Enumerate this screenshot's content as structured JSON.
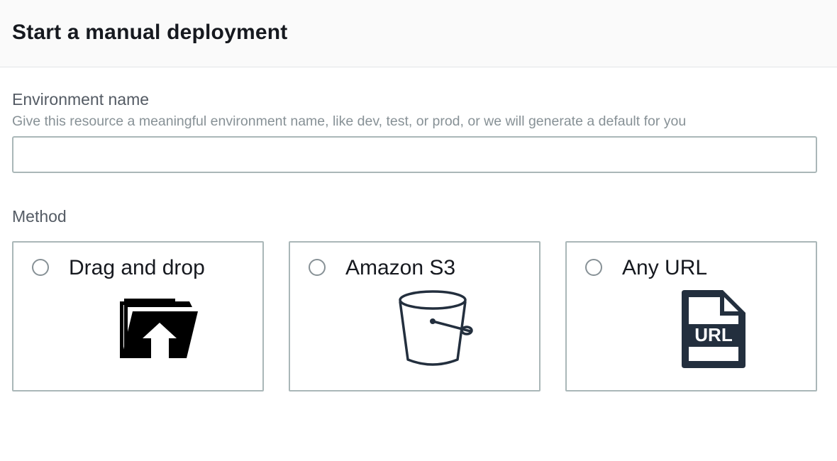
{
  "header": {
    "title": "Start a manual deployment"
  },
  "environment": {
    "label": "Environment name",
    "description": "Give this resource a meaningful environment name, like dev, test, or prod, or we will generate a default for you",
    "value": "",
    "placeholder": ""
  },
  "method": {
    "label": "Method",
    "options": [
      {
        "label": "Drag and drop",
        "icon": "folder-upload-icon",
        "selected": false
      },
      {
        "label": "Amazon S3",
        "icon": "bucket-icon",
        "selected": false
      },
      {
        "label": "Any URL",
        "icon": "url-file-icon",
        "selected": false
      }
    ]
  },
  "colors": {
    "header_bg": "#fafafa",
    "border": "#aab7b8",
    "text": "#16191f",
    "label": "#545b64",
    "description": "#879196"
  }
}
